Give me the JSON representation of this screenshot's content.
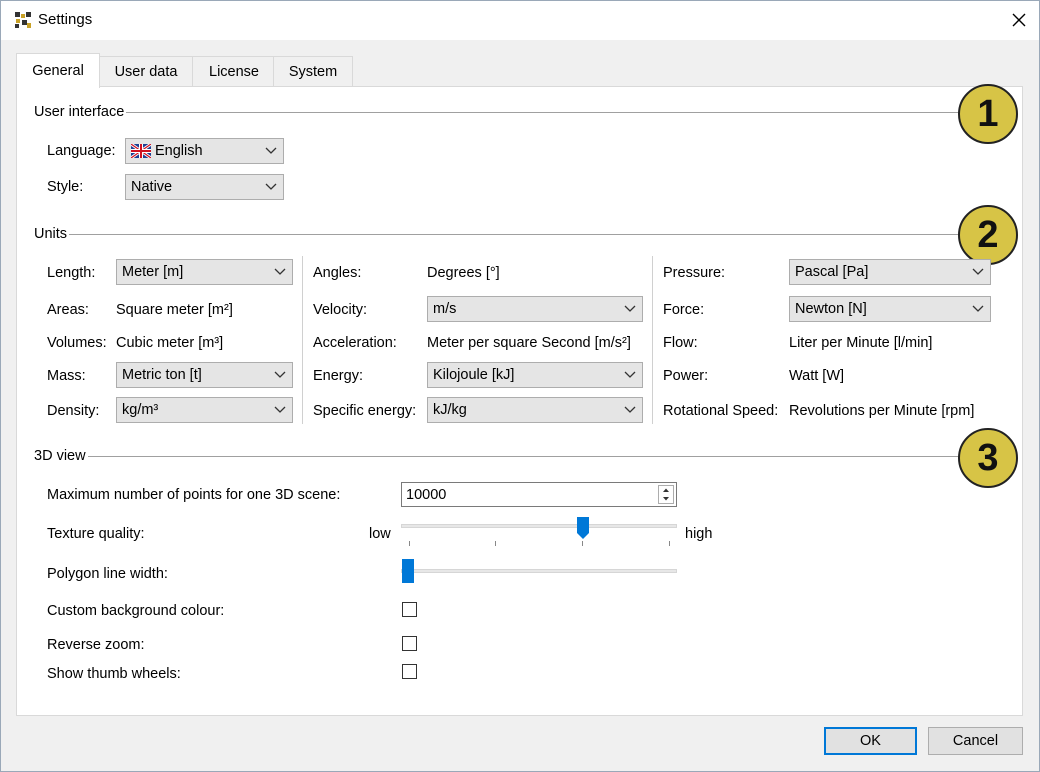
{
  "window": {
    "title": "Settings"
  },
  "tabs": [
    "General",
    "User data",
    "License",
    "System"
  ],
  "sections": {
    "user_interface": {
      "title": "User interface",
      "language_label": "Language:",
      "language_value": "English",
      "style_label": "Style:",
      "style_value": "Native"
    },
    "units": {
      "title": "Units",
      "col1": [
        {
          "label": "Length:",
          "value": "Meter [m]",
          "combo": true
        },
        {
          "label": "Areas:",
          "value": "Square meter [m²]",
          "combo": false
        },
        {
          "label": "Volumes:",
          "value": "Cubic meter [m³]",
          "combo": false
        },
        {
          "label": "Mass:",
          "value": "Metric ton [t]",
          "combo": true
        },
        {
          "label": "Density:",
          "value": "kg/m³",
          "combo": true
        }
      ],
      "col2": [
        {
          "label": "Angles:",
          "value": "Degrees [°]",
          "combo": false
        },
        {
          "label": "Velocity:",
          "value": "m/s",
          "combo": true
        },
        {
          "label": "Acceleration:",
          "value": "Meter per square Second [m/s²]",
          "combo": false
        },
        {
          "label": "Energy:",
          "value": "Kilojoule [kJ]",
          "combo": true
        },
        {
          "label": "Specific energy:",
          "value": "kJ/kg",
          "combo": true
        }
      ],
      "col3": [
        {
          "label": "Pressure:",
          "value": "Pascal [Pa]",
          "combo": true
        },
        {
          "label": "Force:",
          "value": "Newton [N]",
          "combo": true
        },
        {
          "label": "Flow:",
          "value": "Liter per Minute [l/min]",
          "combo": false
        },
        {
          "label": "Power:",
          "value": "Watt [W]",
          "combo": false
        },
        {
          "label": "Rotational Speed:",
          "value": "Revolutions per Minute [rpm]",
          "combo": false
        }
      ]
    },
    "view3d": {
      "title": "3D view",
      "max_points_label": "Maximum number of points for one 3D scene:",
      "max_points_value": "10000",
      "texture_label": "Texture quality:",
      "texture_low": "low",
      "texture_high": "high",
      "texture_level": 0.67,
      "polygon_label": "Polygon line width:",
      "polygon_level": 0.0,
      "custom_bg_label": "Custom background colour:",
      "reverse_zoom_label": "Reverse zoom:",
      "thumb_wheels_label": "Show thumb wheels:"
    }
  },
  "badges": [
    "1",
    "2",
    "3"
  ],
  "buttons": {
    "ok": "OK",
    "cancel": "Cancel"
  },
  "colors": {
    "accent": "#0078d7",
    "badge": "#d7c446"
  }
}
